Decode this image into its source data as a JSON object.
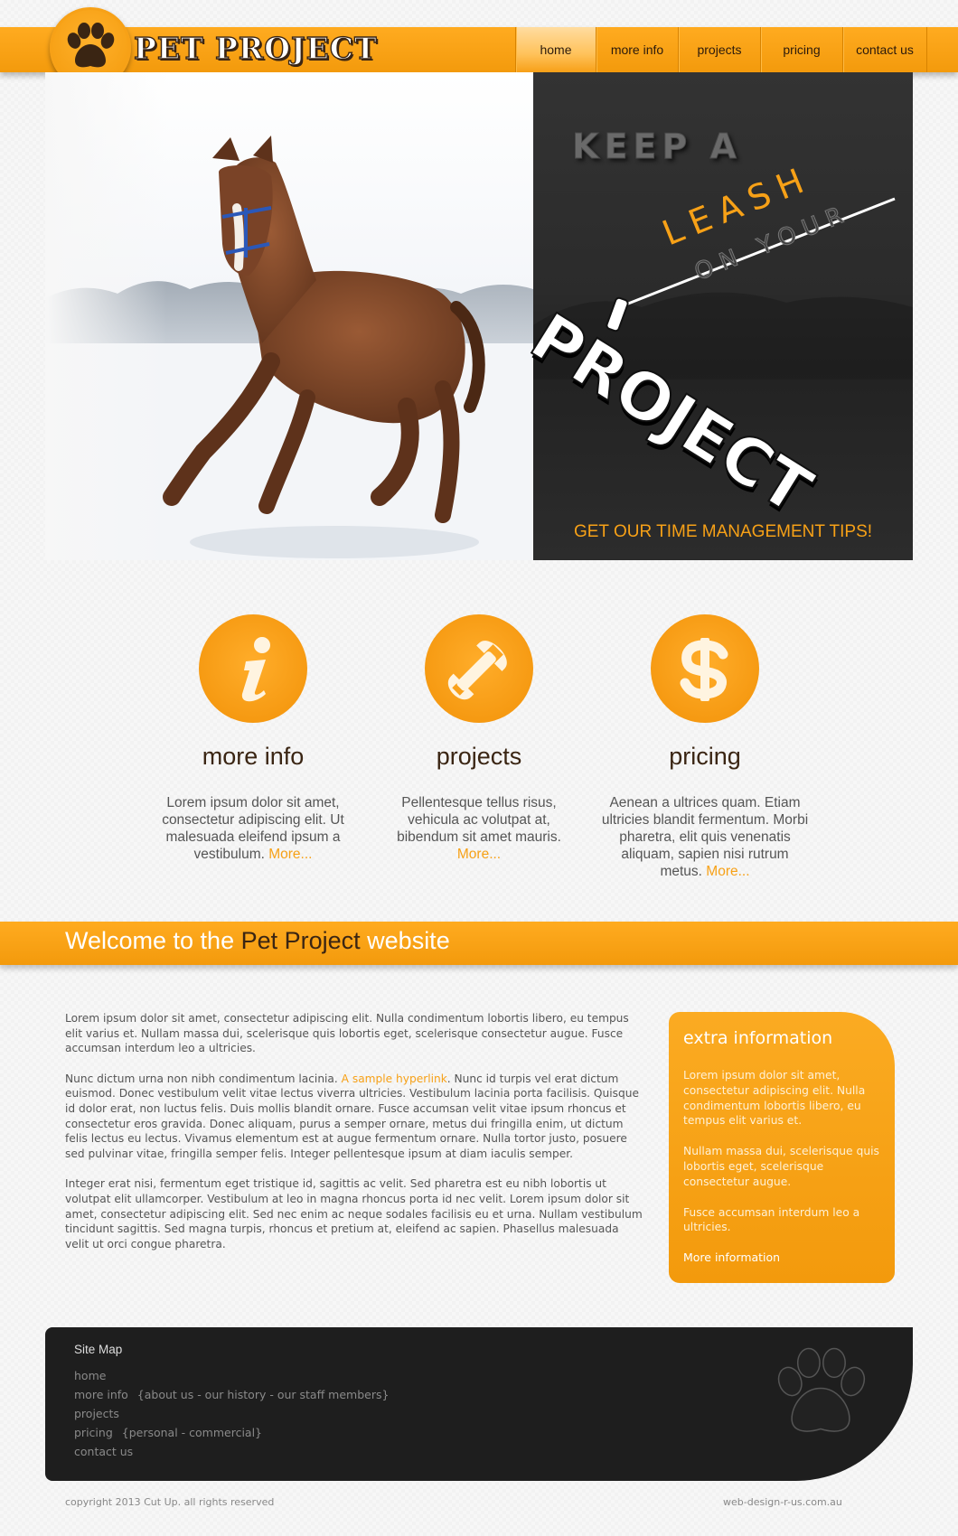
{
  "brand": {
    "name": "PET PROJECT",
    "accent": "#f7a117",
    "dark": "#3a2513"
  },
  "nav": [
    {
      "label": "home",
      "active": true
    },
    {
      "label": "more info"
    },
    {
      "label": "projects"
    },
    {
      "label": "pricing"
    },
    {
      "label": "contact us"
    }
  ],
  "hero": {
    "line1": "KEEP A",
    "line2": "LEASH",
    "line3": "ON YOUR",
    "line4": "PROJECT",
    "cta": "GET OUR TIME MANAGEMENT TIPS!"
  },
  "features": [
    {
      "icon": "info-icon",
      "title": "more info",
      "text": "Lorem ipsum dolor sit amet, consectetur adipiscing elit. Ut malesuada eleifend ipsum a vestibulum. ",
      "more": "More..."
    },
    {
      "icon": "wrench-icon",
      "title": "projects",
      "text": "Pellentesque tellus risus, vehicula ac volutpat at, bibendum sit amet mauris. ",
      "more": "More..."
    },
    {
      "icon": "dollar-icon",
      "title": "pricing",
      "text": "Aenean a ultrices quam. Etiam ultricies blandit fermentum. Morbi pharetra, elit quis venenatis aliquam, sapien nisi rutrum metus. ",
      "more": "More..."
    }
  ],
  "welcome": {
    "prefix": "Welcome to the ",
    "brand": "Pet Project",
    "suffix": " website"
  },
  "content": {
    "p1": "Lorem ipsum dolor sit amet, consectetur adipiscing elit. Nulla condimentum lobortis libero, eu tempus elit varius et. Nullam massa dui, scelerisque quis lobortis eget, scelerisque consectetur augue. Fusce accumsan interdum leo a ultricies.",
    "p2_before": "Nunc dictum urna non nibh condimentum lacinia. ",
    "p2_link": "A sample hyperlink",
    "p2_after": ". Nunc id turpis vel erat dictum euismod. Donec vestibulum velit vitae lectus viverra ultricies. Vestibulum lacinia porta facilisis. Quisque id dolor erat, non luctus felis. Duis mollis blandit ornare. Fusce accumsan velit vitae ipsum rhoncus et consectetur eros gravida. Donec aliquam, purus a semper ornare, metus dui fringilla enim, ut dictum felis lectus eu lectus. Vivamus elementum est at augue fermentum ornare. Nulla tortor justo, posuere sed pulvinar vitae, fringilla semper felis. Integer pellentesque ipsum at diam iaculis semper.",
    "p3": "Integer erat nisi, fermentum eget tristique id, sagittis ac velit. Sed pharetra est eu nibh lobortis ut volutpat elit ullamcorper. Vestibulum at leo in magna rhoncus porta id nec velit. Lorem ipsum dolor sit amet, consectetur adipiscing elit. Sed nec enim ac neque sodales facilisis eu et urna. Nullam vestibulum tincidunt sagittis. Sed magna turpis, rhoncus et pretium at, eleifend ac sapien. Phasellus malesuada velit ut orci congue pharetra."
  },
  "extra": {
    "title": "extra information",
    "p1": "Lorem ipsum dolor sit amet, consectetur adipiscing elit. Nulla condimentum lobortis libero, eu tempus elit varius et.",
    "p2": "Nullam massa dui, scelerisque quis lobortis eget, scelerisque consectetur augue.",
    "p3": "Fusce accumsan interdum leo a ultricies.",
    "link": "More information"
  },
  "footer": {
    "title": "Site Map",
    "links": [
      {
        "label": "home",
        "sub": ""
      },
      {
        "label": "more info",
        "sub": "{about us - our history - our staff members}"
      },
      {
        "label": "projects",
        "sub": ""
      },
      {
        "label": "pricing",
        "sub": "{personal - commercial}"
      },
      {
        "label": "contact us",
        "sub": ""
      }
    ],
    "copyright": "copyright 2013 Cut Up. all rights reserved",
    "credit": "web-design-r-us.com.au"
  }
}
